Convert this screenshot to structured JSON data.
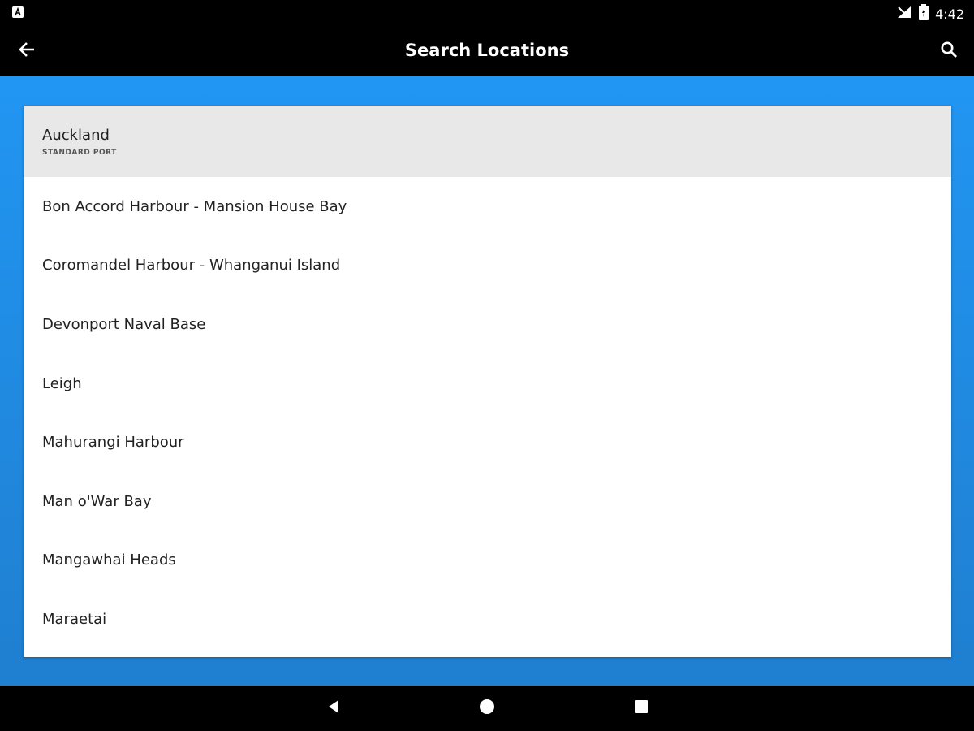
{
  "status_bar": {
    "time": "4:42",
    "icons": [
      "notification-icon",
      "signal-icon",
      "battery-icon"
    ]
  },
  "app_bar": {
    "title": "Search Locations",
    "icons": [
      "back-arrow-icon",
      "search-icon"
    ]
  },
  "colors": {
    "app_bar": "#000000",
    "content_bg_top": "#2196f3",
    "content_bg_bottom": "#1f7fd0",
    "selected_row": "#e8e8e8"
  },
  "locations": [
    {
      "name": "Auckland",
      "subtitle": "STANDARD PORT",
      "selected": true
    },
    {
      "name": "Bon Accord Harbour - Mansion House Bay"
    },
    {
      "name": "Coromandel Harbour - Whanganui Island"
    },
    {
      "name": "Devonport Naval Base"
    },
    {
      "name": "Leigh"
    },
    {
      "name": "Mahurangi Harbour"
    },
    {
      "name": "Man o'War Bay"
    },
    {
      "name": "Mangawhai Heads"
    },
    {
      "name": "Maraetai"
    }
  ],
  "nav_bar": {
    "icons": [
      "back-triangle-icon",
      "home-circle-icon",
      "recents-square-icon"
    ]
  }
}
